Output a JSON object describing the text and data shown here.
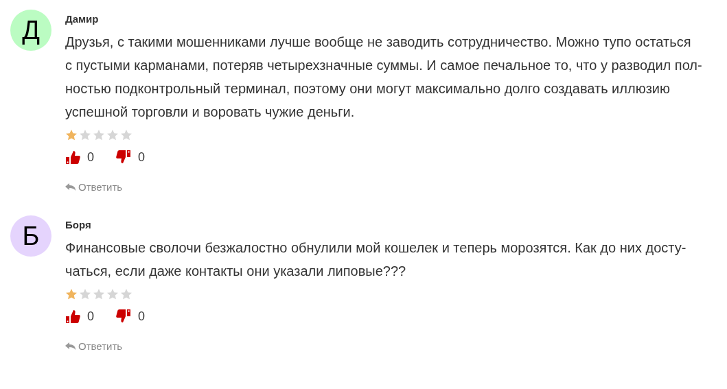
{
  "comments": [
    {
      "initial": "Д",
      "color": "#bbfcc2",
      "author": "Дамир",
      "lines": [
        "Друзья, с такими мошенниками лучше вообще не заводить сотрудничество. Можно тупо остаться",
        "с пустыми карманами, потеряв четырехзначные суммы. И самое печальное то, что у разводил пол-",
        "ностью подконтрольный терминал, поэтому они могут максимально долго создавать иллюзию",
        "успешной торговли и воровать чужие деньги."
      ],
      "stars": 1,
      "likes": "0",
      "dislikes": "0",
      "reply": "Ответить"
    },
    {
      "initial": "Б",
      "color": "#e5d4fd",
      "author": "Боря",
      "lines": [
        "Финансовые сволочи безжалостно обнулили мой кошелек и теперь морозятся. Как до них досту-",
        "чаться, если даже контакты они указали липовые???"
      ],
      "stars": 1,
      "likes": "0",
      "dislikes": "0",
      "reply": "Ответить"
    }
  ]
}
